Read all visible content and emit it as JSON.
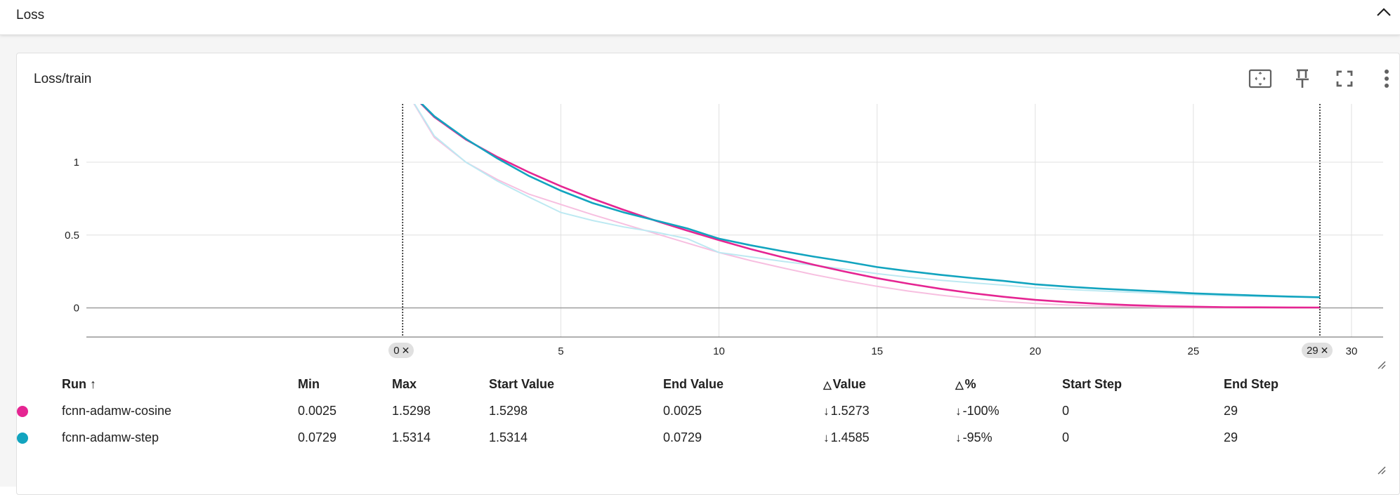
{
  "section": {
    "title": "Loss"
  },
  "card": {
    "title": "Loss/train"
  },
  "toolbar": {
    "icons": [
      "fit-to-domain-icon",
      "pin-icon",
      "fullscreen-icon",
      "more-vert-icon"
    ]
  },
  "chart_data": {
    "type": "line",
    "title": "Loss/train",
    "xlabel": "",
    "ylabel": "",
    "xlim": [
      -10,
      31
    ],
    "ylim": [
      -0.2,
      1.4
    ],
    "x_ticks": [
      5,
      10,
      15,
      20,
      25,
      30
    ],
    "y_ticks": [
      0,
      0.5,
      1
    ],
    "grid": true,
    "step_range": {
      "start": 0,
      "end": 29
    },
    "series": [
      {
        "name": "fcnn-adamw-cosine",
        "color": "#e52592",
        "raw_color": "#f7bfe0",
        "x": [
          0,
          1,
          2,
          3,
          4,
          5,
          6,
          7,
          8,
          9,
          10,
          11,
          12,
          13,
          14,
          15,
          16,
          17,
          18,
          19,
          20,
          21,
          22,
          23,
          24,
          25,
          26,
          27,
          28,
          29
        ],
        "smoothed": [
          1.5298,
          1.31,
          1.155,
          1.035,
          0.93,
          0.835,
          0.75,
          0.672,
          0.598,
          0.53,
          0.465,
          0.404,
          0.348,
          0.296,
          0.248,
          0.204,
          0.166,
          0.131,
          0.101,
          0.076,
          0.055,
          0.04,
          0.028,
          0.019,
          0.012,
          0.008,
          0.005,
          0.004,
          0.003,
          0.0025
        ],
        "raw": [
          1.5298,
          1.17,
          1.0,
          0.88,
          0.78,
          0.71,
          0.64,
          0.575,
          0.51,
          0.445,
          0.38,
          0.325,
          0.275,
          0.228,
          0.186,
          0.148,
          0.115,
          0.087,
          0.064,
          0.045,
          0.03,
          0.02,
          0.013,
          0.008,
          0.005,
          0.004,
          0.003,
          0.003,
          0.0025,
          0.0025
        ]
      },
      {
        "name": "fcnn-adamw-step",
        "color": "#12a4bf",
        "raw_color": "#bde9f2",
        "x": [
          0,
          1,
          2,
          3,
          4,
          5,
          6,
          7,
          8,
          9,
          10,
          11,
          12,
          13,
          14,
          15,
          16,
          17,
          18,
          19,
          20,
          21,
          22,
          23,
          24,
          25,
          26,
          27,
          28,
          29
        ],
        "smoothed": [
          1.5314,
          1.315,
          1.16,
          1.025,
          0.905,
          0.805,
          0.72,
          0.655,
          0.6,
          0.545,
          0.475,
          0.43,
          0.39,
          0.352,
          0.318,
          0.28,
          0.252,
          0.227,
          0.205,
          0.185,
          0.162,
          0.146,
          0.133,
          0.122,
          0.112,
          0.1,
          0.092,
          0.085,
          0.078,
          0.0729
        ],
        "raw": [
          1.5314,
          1.18,
          1.0,
          0.87,
          0.76,
          0.655,
          0.6,
          0.555,
          0.52,
          0.475,
          0.38,
          0.35,
          0.32,
          0.292,
          0.265,
          0.235,
          0.21,
          0.19,
          0.172,
          0.156,
          0.138,
          0.127,
          0.117,
          0.108,
          0.1,
          0.09,
          0.084,
          0.078,
          0.075,
          0.0729
        ]
      }
    ]
  },
  "range_chips": {
    "start": "0",
    "end": "29",
    "close": "✕"
  },
  "table": {
    "headers": {
      "run": "Run",
      "sort_arrow": "↑",
      "min": "Min",
      "max": "Max",
      "start_value": "Start Value",
      "end_value": "End Value",
      "delta_value": "Value",
      "delta_pct": "%",
      "delta_symbol": "△",
      "start_step": "Start Step",
      "end_step": "End Step"
    },
    "rows": [
      {
        "color": "#e52592",
        "run": "fcnn-adamw-cosine",
        "min": "0.0025",
        "max": "1.5298",
        "start_value": "1.5298",
        "end_value": "0.0025",
        "delta_arrow": "↓",
        "delta_value": "1.5273",
        "delta_pct": "-100%",
        "start_step": "0",
        "end_step": "29"
      },
      {
        "color": "#12a4bf",
        "run": "fcnn-adamw-step",
        "min": "0.0729",
        "max": "1.5314",
        "start_value": "1.5314",
        "end_value": "0.0729",
        "delta_arrow": "↓",
        "delta_value": "1.4585",
        "delta_pct": "-95%",
        "start_step": "0",
        "end_step": "29"
      }
    ]
  }
}
